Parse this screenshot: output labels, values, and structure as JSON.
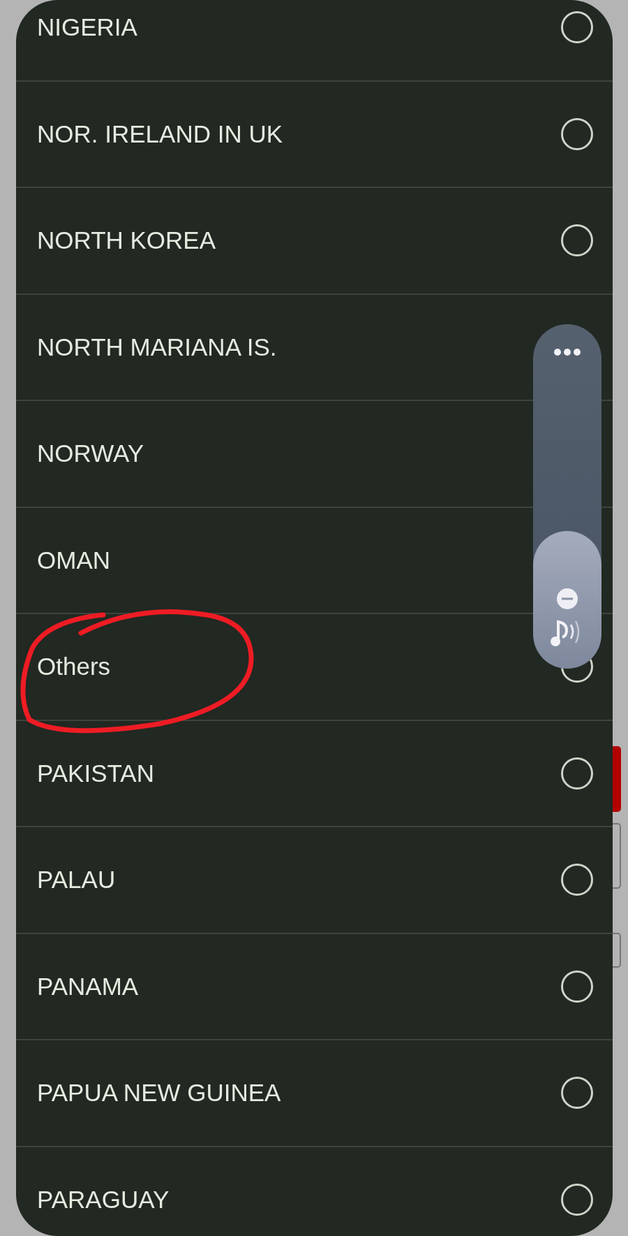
{
  "countries": [
    {
      "label": "NIGERIA",
      "selected": false
    },
    {
      "label": "NOR. IRELAND IN UK",
      "selected": false
    },
    {
      "label": "NORTH KOREA",
      "selected": false
    },
    {
      "label": "NORTH MARIANA IS."
    },
    {
      "label": "NORWAY"
    },
    {
      "label": "OMAN"
    },
    {
      "label": "Others",
      "selected": false
    },
    {
      "label": "PAKISTAN",
      "selected": false
    },
    {
      "label": "PALAU",
      "selected": false
    },
    {
      "label": "PANAMA",
      "selected": false
    },
    {
      "label": "PAPUA NEW GUINEA",
      "selected": false
    },
    {
      "label": "PARAGUAY",
      "selected": false
    }
  ],
  "volume": {
    "level": 0.4
  }
}
